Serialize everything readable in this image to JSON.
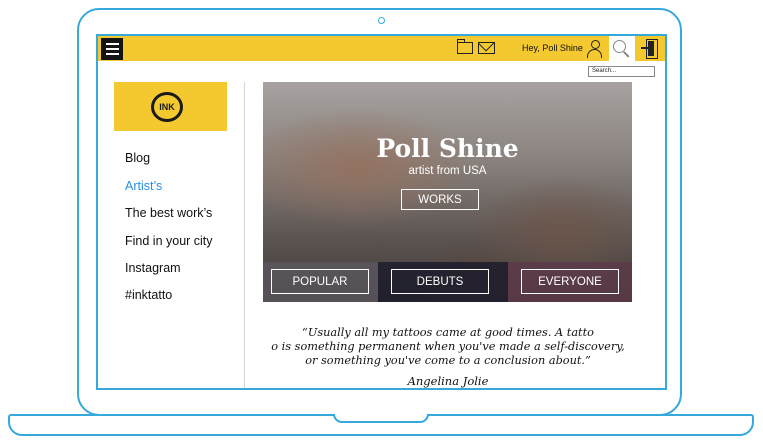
{
  "colors": {
    "frame": "#35a8dc",
    "accent": "#f4c930",
    "active_link": "#2c8fe0"
  },
  "topbar": {
    "menu_icon": "hamburger-icon",
    "folder_icon": "folder-icon",
    "mail_icon": "mail-icon",
    "greeting": "Hey, Poll Shine",
    "user_icon": "user-icon",
    "search_icon": "search-icon",
    "exit_icon": "exit-door-icon",
    "search_placeholder": "Search..."
  },
  "logo": {
    "text": "INK"
  },
  "nav": {
    "items": [
      {
        "label": "Blog",
        "active": false
      },
      {
        "label": "Artist’s",
        "active": true
      },
      {
        "label": "The best work’s",
        "active": false
      },
      {
        "label": "Find in your city",
        "active": false
      },
      {
        "label": "Instagram",
        "active": false
      },
      {
        "label": "#inktatto",
        "active": false
      }
    ]
  },
  "hero": {
    "title": "Poll Shine",
    "subtitle": "artist from USA",
    "works_label": "WORKS",
    "categories": [
      "POPULAR",
      "DEBUTS",
      "EVERYONE"
    ]
  },
  "quote": {
    "lines": [
      "“Usually all my tattoos came at good times. A tatto",
      "o is something permanent when you've made a self-discovery,",
      "or something you've come to a conclusion about.”"
    ],
    "author": "Angelina Jolie"
  }
}
